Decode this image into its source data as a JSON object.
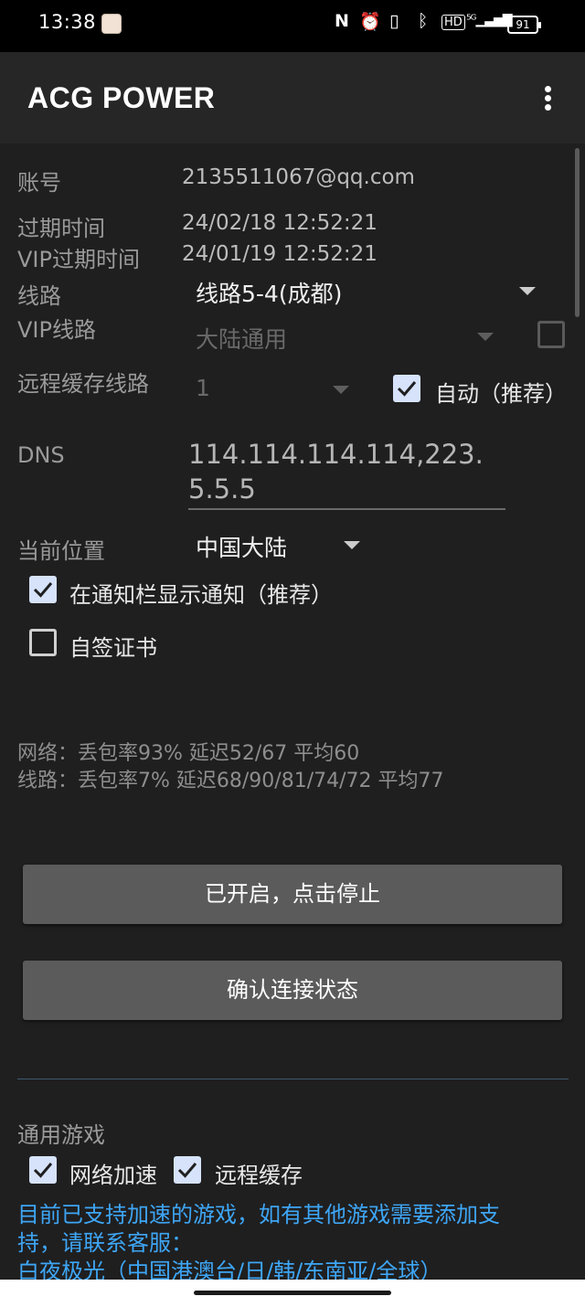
{
  "status_bar": {
    "time": "13:38",
    "battery": "91",
    "icons": [
      "nfc-icon",
      "alarm-icon",
      "vibrate-icon",
      "bluetooth-icon",
      "hd-icon",
      "signal-5g-icon",
      "battery-icon"
    ],
    "nfc": "N",
    "alarm": "⏰",
    "vibrate": "▯",
    "bluetooth": "ᛒ",
    "hd": "HD",
    "signal": "⁵ᴳ▁▃▅▇"
  },
  "app_bar": {
    "title": "ACG POWER",
    "menu_icon": "more-vert-icon"
  },
  "account": {
    "label": "账号",
    "value": "2135511067@qq.com"
  },
  "expire": {
    "label": "过期时间",
    "value": "24/02/18 12:52:21"
  },
  "vip_expire": {
    "label": "VIP过期时间",
    "value": "24/01/19 12:52:21"
  },
  "line": {
    "label": "线路",
    "selected": "线路5-4(成都)"
  },
  "vip_line": {
    "label": "VIP线路",
    "selected": "大陆通用",
    "checked": false
  },
  "remote_cache": {
    "label": "远程缓存线路",
    "selected": "1",
    "auto_label": "自动（推荐）",
    "auto_checked": true
  },
  "dns": {
    "label": "DNS",
    "value": "114.114.114.114,223.5.5.5"
  },
  "location": {
    "label": "当前位置",
    "selected": "中国大陆"
  },
  "notify": {
    "label": "在通知栏显示通知（推荐）",
    "checked": true
  },
  "self_cert": {
    "label": "自签证书",
    "checked": false
  },
  "stats": {
    "network": "网络：丢包率93% 延迟52/67 平均60",
    "line": "线路：丢包率7% 延迟68/90/81/74/72 平均77"
  },
  "buttons": {
    "toggle": "已开启，点击停止",
    "check": "确认连接状态"
  },
  "games": {
    "section_title": "通用游戏",
    "net_accel": {
      "label": "网络加速",
      "checked": true
    },
    "remote_cache": {
      "label": "远程缓存",
      "checked": true
    },
    "info": "目前已支持加速的游戏，如有其他游戏需要添加支持，请联系客服：",
    "game_list": "白夜极光（中国港澳台/日/韩/东南亚/全球）"
  },
  "colors": {
    "background": "#1f1f20",
    "app_bar": "#262626",
    "link_blue": "#3ea6f5",
    "checkbox_fill": "#d6e3fb",
    "button": "#5b5b5b"
  }
}
